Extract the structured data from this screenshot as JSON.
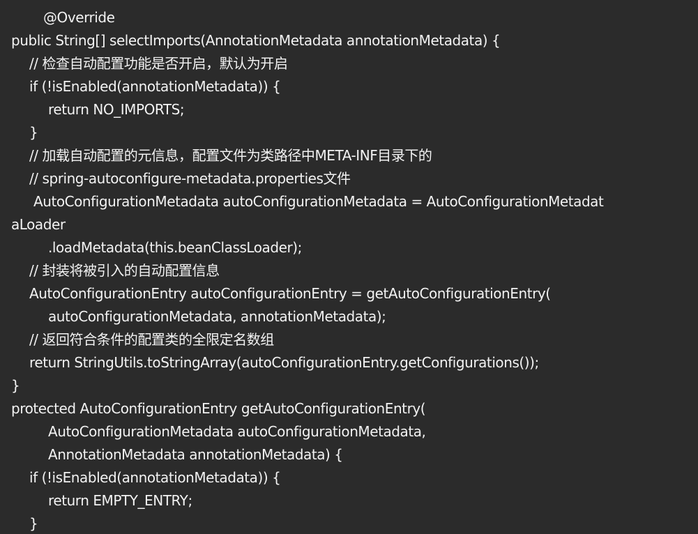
{
  "code": {
    "lines": [
      "@Override",
      "public String[] selectImports(AnnotationMetadata annotationMetadata) {",
      "// 检查自动配置功能是否开启，默认为开启",
      "if (!isEnabled(annotationMetadata)) {",
      "return NO_IMPORTS;",
      "}",
      "// 加载自动配置的元信息，配置文件为类路径中META-INF目录下的",
      "// spring-autoconfigure-metadata.properties文件",
      "AutoConfigurationMetadata autoConfigurationMetadata = AutoConfigurationMetadat",
      "aLoader",
      ".loadMetadata(this.beanClassLoader);",
      "// 封装将被引入的自动配置信息",
      "AutoConfigurationEntry autoConfigurationEntry = getAutoConfigurationEntry(",
      "autoConfigurationMetadata, annotationMetadata);",
      "// 返回符合条件的配置类的全限定名数组",
      "return StringUtils.toStringArray(autoConfigurationEntry.getConfigurations());",
      "}",
      "protected AutoConfigurationEntry getAutoConfigurationEntry(",
      "AutoConfigurationMetadata autoConfigurationMetadata,",
      "AnnotationMetadata annotationMetadata) {",
      "if (!isEnabled(annotationMetadata)) {",
      "return EMPTY_ENTRY;",
      "}"
    ]
  }
}
